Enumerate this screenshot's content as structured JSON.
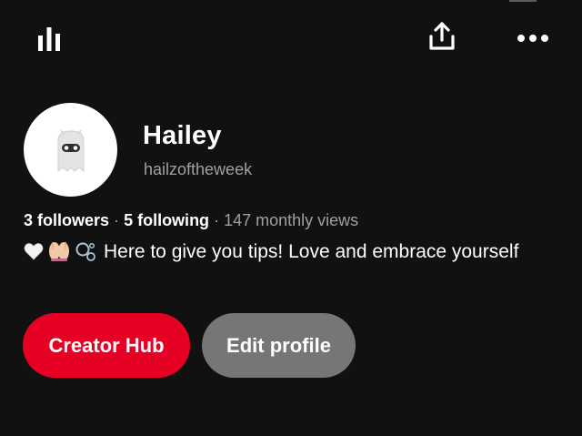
{
  "colors": {
    "background": "#111111",
    "primary_button": "#e60023",
    "secondary_button": "#767676",
    "muted_text": "#a0a0a0"
  },
  "header": {
    "icons": [
      "bar-chart-icon",
      "share-icon",
      "more-icon"
    ]
  },
  "profile": {
    "avatar_icon": "ghost-icon",
    "name": "Hailey",
    "username": "hailzoftheweek",
    "followers": "3 followers",
    "following": "5 following",
    "monthly_views": "147 monthly views",
    "separator": "·",
    "bio_emojis": [
      "white-heart-icon",
      "palms-up-icon",
      "bubbles-icon"
    ],
    "bio_text": "Here to give you tips!  Love and embrace yourself"
  },
  "actions": {
    "creator_hub_label": "Creator Hub",
    "edit_profile_label": "Edit profile"
  }
}
